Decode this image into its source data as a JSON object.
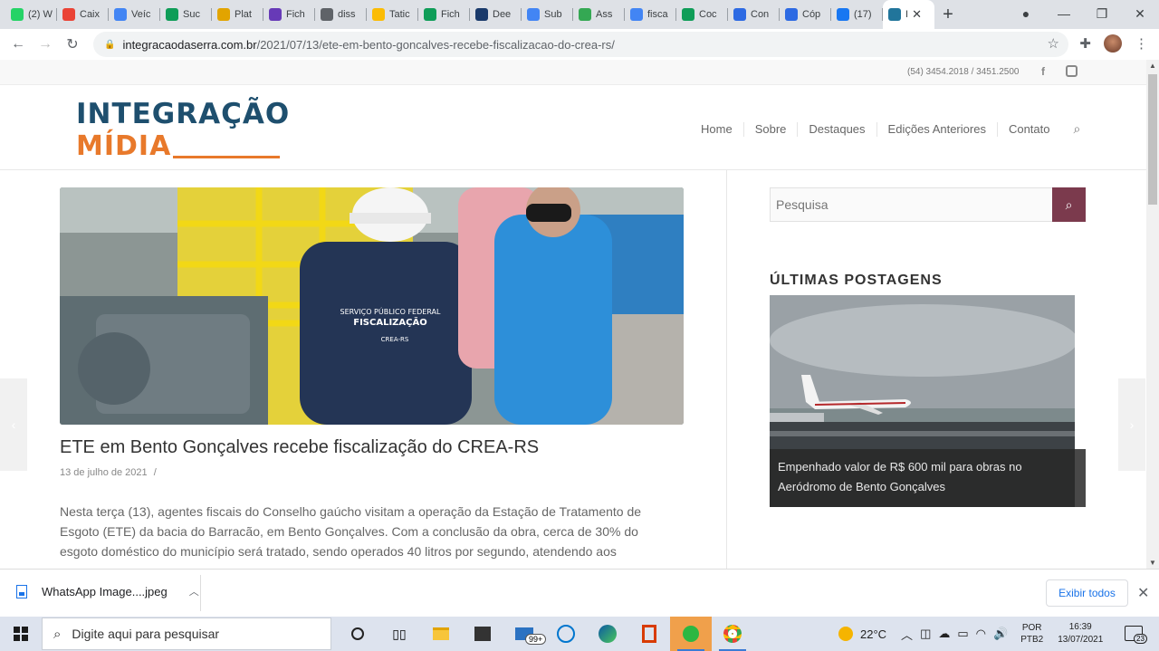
{
  "browser": {
    "tabs": [
      {
        "label": "(2) W",
        "color": "#25d366"
      },
      {
        "label": "Caix",
        "color": "#ea4335"
      },
      {
        "label": "Veíc",
        "color": "#4285f4"
      },
      {
        "label": "Suc",
        "color": "#0f9d58"
      },
      {
        "label": "Plat",
        "color": "#e2a400"
      },
      {
        "label": "Fich",
        "color": "#673ab7"
      },
      {
        "label": "diss",
        "color": "#5f6368"
      },
      {
        "label": "Tatic",
        "color": "#fbbc04"
      },
      {
        "label": "Fich",
        "color": "#0f9d58"
      },
      {
        "label": "Dee",
        "color": "#1a3a6b"
      },
      {
        "label": "Sub",
        "color": "#4285f4"
      },
      {
        "label": "Ass",
        "color": "#34a853"
      },
      {
        "label": "fisca",
        "color": "#4285f4"
      },
      {
        "label": "Coc",
        "color": "#0f9d58"
      },
      {
        "label": "Con",
        "color": "#2d6ae3"
      },
      {
        "label": "Cóp",
        "color": "#2d6ae3"
      },
      {
        "label": "(17)",
        "color": "#1877f2"
      },
      {
        "label": "I",
        "color": "#21759b"
      }
    ],
    "url_host": "integracaodaserra.com.br",
    "url_path": "/2021/07/13/ete-em-bento-goncalves-recebe-fiscalizacao-do-crea-rs/"
  },
  "site": {
    "phone": "(54) 3454.2018 / 3451.2500",
    "logo_line1": "INTEGRAÇÃO",
    "logo_line2": "MÍDIA",
    "menu": [
      "Home",
      "Sobre",
      "Destaques",
      "Edições Anteriores",
      "Contato"
    ],
    "hero_vest_line1": "SERVIÇO PÚBLICO FEDERAL",
    "hero_vest_line2": "FISCALIZAÇÃO",
    "hero_vest_line3": "CREA-RS",
    "post_title": "ETE em Bento Gonçalves recebe fiscalização do CREA-RS",
    "post_date": "13 de julho de 2021",
    "post_date_sep": "/",
    "post_body": "Nesta terça (13), agentes fiscais do Conselho gaúcho visitam a operação da Estação de Tratamento de Esgoto (ETE) da bacia do Barracão, em Bento Gonçalves. Com a conclusão da obra, cerca de 30% do esgoto doméstico do município será tratado, sendo operados 40 litros por segundo, atendendo aos",
    "search_placeholder": "Pesquisa",
    "widget_title": "ÚLTIMAS POSTAGENS",
    "latest_caption": "Empenhado valor de R$ 600 mil para obras no Aeródromo de Bento Gonçalves"
  },
  "download": {
    "filename": "WhatsApp Image....jpeg",
    "show_all": "Exibir todos"
  },
  "taskbar": {
    "search_placeholder": "Digite aqui para pesquisar",
    "badge": "99+",
    "temperature": "22°C",
    "lang1": "POR",
    "lang2": "PTB2",
    "time": "16:39",
    "date": "13/07/2021",
    "notifications": "23"
  },
  "colors": {
    "accent": "#7b3a4d",
    "logo_blue": "#1e4f6e",
    "logo_orange": "#e8792b"
  }
}
